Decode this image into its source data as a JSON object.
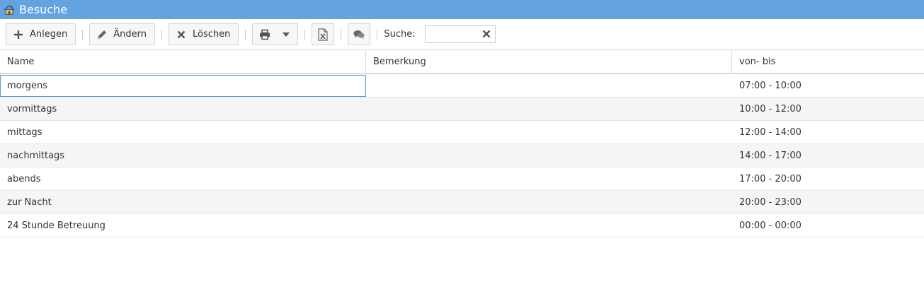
{
  "window": {
    "title": "Besuche",
    "icon": "house-icon"
  },
  "toolbar": {
    "add_label": "Anlegen",
    "edit_label": "Ändern",
    "delete_label": "Löschen",
    "search_label": "Suche:",
    "search_value": ""
  },
  "colors": {
    "titlebar": "#62a3e0",
    "focus_border": "#5b9bd5"
  },
  "table": {
    "columns": [
      "Name",
      "Bemerkung",
      "von- bis"
    ],
    "rows": [
      {
        "name": "morgens",
        "remark": "",
        "time": "07:00 - 10:00"
      },
      {
        "name": "vormittags",
        "remark": "",
        "time": "10:00 - 12:00"
      },
      {
        "name": "mittags",
        "remark": "",
        "time": "12:00 - 14:00"
      },
      {
        "name": "nachmittags",
        "remark": "",
        "time": "14:00 - 17:00"
      },
      {
        "name": "abends",
        "remark": "",
        "time": "17:00 - 20:00"
      },
      {
        "name": "zur Nacht",
        "remark": "",
        "time": "20:00 - 23:00"
      },
      {
        "name": "24 Stunde Betreuung",
        "remark": "",
        "time": "00:00 - 00:00"
      }
    ]
  }
}
